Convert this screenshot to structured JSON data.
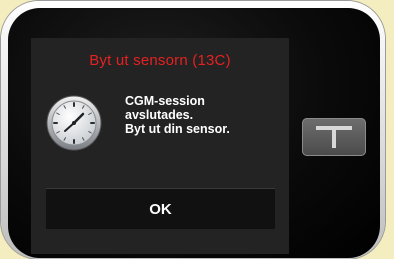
{
  "alert": {
    "title": "Byt ut sensorn (13C)",
    "message_lines": [
      "CGM-session",
      "avslutades.",
      "Byt ut din sensor."
    ],
    "ok_label": "OK"
  },
  "icons": {
    "clock": "clock-icon",
    "t_button": "t-logo-icon"
  },
  "colors": {
    "title": "#e52121",
    "screen_background": "#232323",
    "device_body": "#0a0a0a",
    "page_background": "#f4edbf"
  }
}
